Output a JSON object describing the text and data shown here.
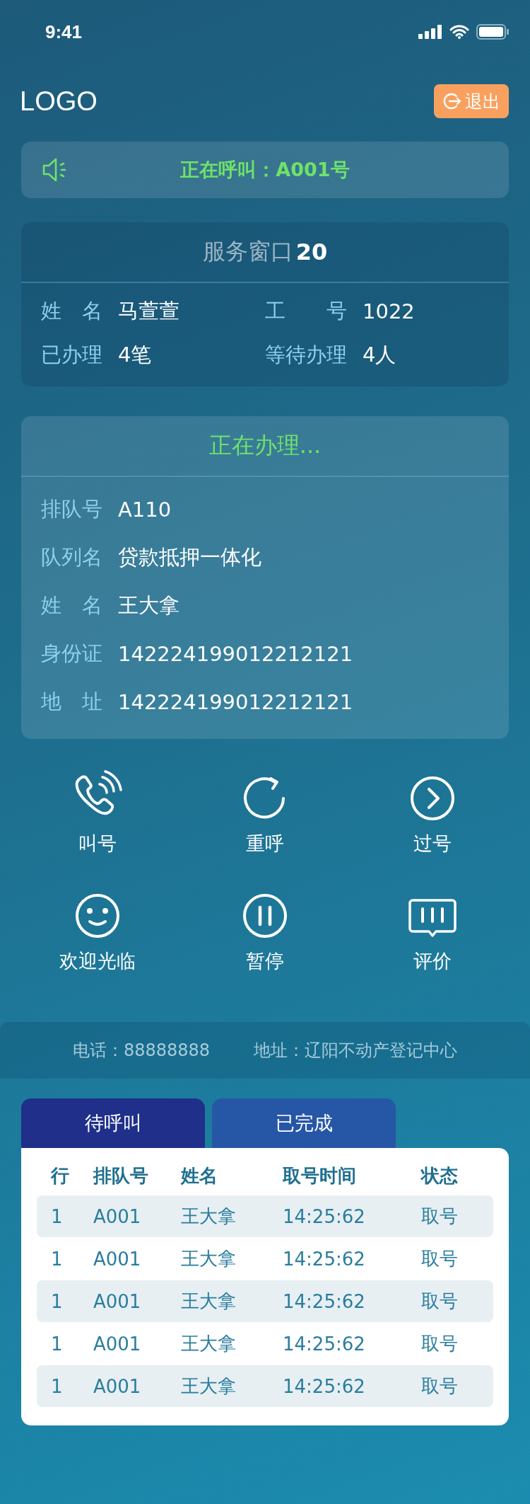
{
  "status_bar": {
    "time": "9:41"
  },
  "header": {
    "logo": "LOGO",
    "logout": "退出"
  },
  "calling": {
    "text": "正在呼叫：A001号"
  },
  "service_window": {
    "title": "服务窗口",
    "number": "20",
    "fields": [
      {
        "label": "姓　名",
        "value": "马萱萱"
      },
      {
        "label": "工　　号",
        "value": "1022"
      },
      {
        "label": "已办理",
        "value": "4笔"
      },
      {
        "label": "等待办理",
        "value": "4人"
      }
    ]
  },
  "processing": {
    "title": "正在办理...",
    "fields": [
      {
        "label": "排队号",
        "value": "A110"
      },
      {
        "label": "队列名",
        "value": "贷款抵押一体化"
      },
      {
        "label": "姓　名",
        "value": "王大拿"
      },
      {
        "label": "身份证",
        "value": "142224199012212121"
      },
      {
        "label": "地　址",
        "value": "142224199012212121"
      }
    ]
  },
  "actions": [
    {
      "kind": "phone",
      "label": "叫号"
    },
    {
      "kind": "recall",
      "label": "重呼"
    },
    {
      "kind": "skip",
      "label": "过号"
    },
    {
      "kind": "smile",
      "label": "欢迎光临"
    },
    {
      "kind": "pause",
      "label": "暂停"
    },
    {
      "kind": "rate",
      "label": "评价"
    }
  ],
  "info_bar": {
    "phone": "电话：88888888",
    "address": "地址：辽阳不动产登记中心"
  },
  "tabs": [
    {
      "label": "待呼叫",
      "selected": true
    },
    {
      "label": "已完成",
      "selected": false
    }
  ],
  "table": {
    "columns": [
      "行",
      "排队号",
      "姓名",
      "取号时间",
      "状态"
    ],
    "rows": [
      [
        "1",
        "A001",
        "王大拿",
        "14:25:62",
        "取号"
      ],
      [
        "1",
        "A001",
        "王大拿",
        "14:25:62",
        "取号"
      ],
      [
        "1",
        "A001",
        "王大拿",
        "14:25:62",
        "取号"
      ],
      [
        "1",
        "A001",
        "王大拿",
        "14:25:62",
        "取号"
      ],
      [
        "1",
        "A001",
        "王大拿",
        "14:25:62",
        "取号"
      ]
    ]
  }
}
